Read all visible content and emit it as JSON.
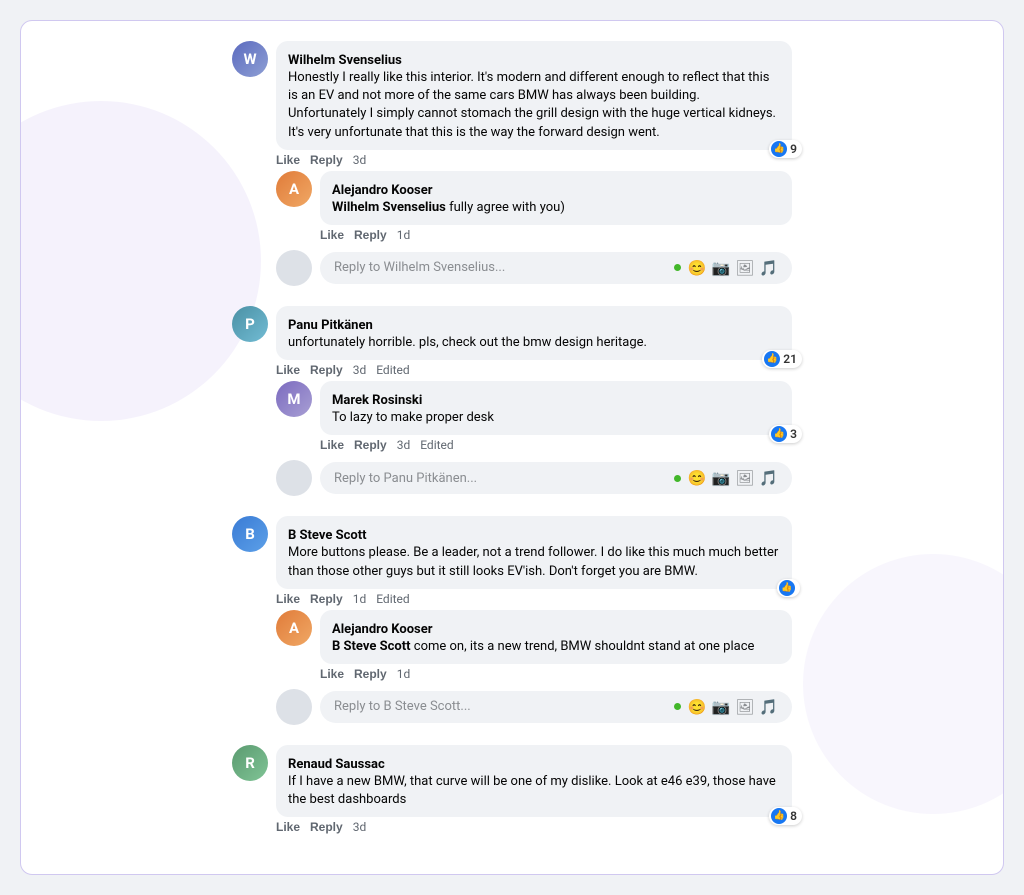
{
  "comments": [
    {
      "id": "c1",
      "author": "Wilhelm Svenselius",
      "avatar_class": "ws",
      "avatar_letter": "W",
      "text": "Honestly I really like this interior. It's modern and different enough to reflect that this is an EV and not more of the same cars BMW has always been building. Unfortunately I simply cannot stomach the grill design with the huge vertical kidneys. It's very unfortunate that this is the way the forward design went.",
      "like_count": "9",
      "time": "3d",
      "edited": false,
      "replies": [
        {
          "id": "c1r1",
          "author": "Alejandro Kooser",
          "avatar_class": "ak",
          "avatar_letter": "A",
          "mention": "Wilhelm Svenselius",
          "text": " fully agree with you)",
          "like_count": null,
          "time": "1d",
          "edited": false
        }
      ],
      "reply_placeholder": "Reply to Wilhelm Svenselius..."
    },
    {
      "id": "c2",
      "author": "Panu Pitkänen",
      "avatar_class": "pp",
      "avatar_letter": "P",
      "text": "unfortunately horrible. pls, check out the bmw design heritage.",
      "like_count": "21",
      "time": "3d",
      "edited": true,
      "replies": [
        {
          "id": "c2r1",
          "author": "Marek Rosinski",
          "avatar_class": "mr",
          "avatar_letter": "M",
          "mention": null,
          "text": "To lazy to make proper desk",
          "like_count": "3",
          "time": "3d",
          "edited": true
        }
      ],
      "reply_placeholder": "Reply to Panu Pitkänen..."
    },
    {
      "id": "c3",
      "author": "B Steve Scott",
      "avatar_class": "bs",
      "avatar_letter": "B",
      "text": "More buttons please. Be a leader, not a trend follower. I do like this much much better than those other guys but it still looks EV'ish. Don't forget you are BMW.",
      "like_count": null,
      "like_icon": true,
      "time": "1d",
      "edited": true,
      "replies": [
        {
          "id": "c3r1",
          "author": "Alejandro Kooser",
          "avatar_class": "ak",
          "avatar_letter": "A",
          "mention": "B Steve Scott",
          "text": " come on, its a new trend, BMW shouldnt stand at one place",
          "like_count": null,
          "time": "1d",
          "edited": false
        }
      ],
      "reply_placeholder": "Reply to B Steve Scott..."
    },
    {
      "id": "c4",
      "author": "Renaud Saussac",
      "avatar_class": "rs",
      "avatar_letter": "R",
      "text": "If I have a new BMW, that curve will be one of my dislike. Look at e46 e39, those have the best dashboards",
      "like_count": "8",
      "time": "3d",
      "edited": false,
      "replies": [],
      "reply_placeholder": null
    }
  ],
  "labels": {
    "like": "Like",
    "reply": "Reply"
  }
}
